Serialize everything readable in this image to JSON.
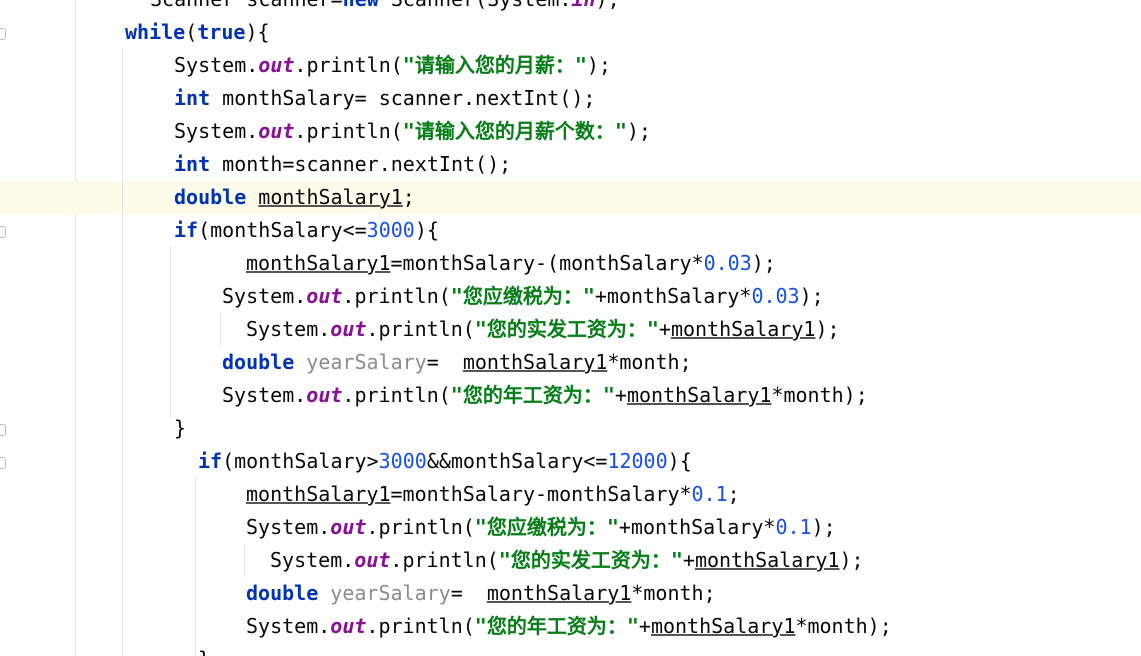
{
  "editor": {
    "language": "Java",
    "colors": {
      "keyword": "#0033b3",
      "static_field": "#871094",
      "string": "#067d17",
      "number": "#1750eb",
      "plain": "#080808",
      "unused_variable": "#8c8c8c",
      "current_line_highlight": "#fdfbe9"
    },
    "lines": [
      {
        "tokens": [
          {
            "t": "Scanner ",
            "c": "plain"
          },
          {
            "t": "scanner",
            "c": "plain"
          },
          {
            "t": "=",
            "c": "plain"
          },
          {
            "t": "new",
            "c": "kw"
          },
          {
            "t": " Scanner(System.",
            "c": "plain"
          },
          {
            "t": "in",
            "c": "fld"
          },
          {
            "t": ");",
            "c": "plain"
          }
        ]
      },
      {
        "tokens": [
          {
            "t": "while",
            "c": "kw"
          },
          {
            "t": "(",
            "c": "plain"
          },
          {
            "t": "true",
            "c": "kw"
          },
          {
            "t": "){",
            "c": "plain"
          }
        ]
      },
      {
        "tokens": [
          {
            "t": "System.",
            "c": "plain"
          },
          {
            "t": "out",
            "c": "fld"
          },
          {
            "t": ".println(",
            "c": "plain"
          },
          {
            "t": "\"",
            "c": "str"
          },
          {
            "t": "请输入您的月薪：",
            "c": "str cjk"
          },
          {
            "t": "\"",
            "c": "str"
          },
          {
            "t": ");",
            "c": "plain"
          }
        ]
      },
      {
        "tokens": [
          {
            "t": "int",
            "c": "kw"
          },
          {
            "t": " monthSalary= scanner.nextInt();",
            "c": "plain"
          }
        ]
      },
      {
        "tokens": [
          {
            "t": "System.",
            "c": "plain"
          },
          {
            "t": "out",
            "c": "fld"
          },
          {
            "t": ".println(",
            "c": "plain"
          },
          {
            "t": "\"",
            "c": "str"
          },
          {
            "t": "请输入您的月薪个数：",
            "c": "str cjk"
          },
          {
            "t": "\"",
            "c": "str"
          },
          {
            "t": ");",
            "c": "plain"
          }
        ]
      },
      {
        "tokens": [
          {
            "t": "int",
            "c": "kw"
          },
          {
            "t": " month=scanner.nextInt();",
            "c": "plain"
          }
        ]
      },
      {
        "tokens": [
          {
            "t": "double",
            "c": "kw"
          },
          {
            "t": " ",
            "c": "plain"
          },
          {
            "t": "monthSalary1",
            "c": "var"
          },
          {
            "t": ";",
            "c": "plain"
          }
        ]
      },
      {
        "tokens": [
          {
            "t": "if",
            "c": "kw"
          },
          {
            "t": "(monthSalary<=",
            "c": "plain"
          },
          {
            "t": "3000",
            "c": "num"
          },
          {
            "t": "){",
            "c": "plain"
          }
        ]
      },
      {
        "tokens": [
          {
            "t": "monthSalary1",
            "c": "var"
          },
          {
            "t": "=monthSalary-(monthSalary*",
            "c": "plain"
          },
          {
            "t": "0.03",
            "c": "num"
          },
          {
            "t": ");",
            "c": "plain"
          }
        ]
      },
      {
        "tokens": [
          {
            "t": "System.",
            "c": "plain"
          },
          {
            "t": "out",
            "c": "fld"
          },
          {
            "t": ".println(",
            "c": "plain"
          },
          {
            "t": "\"",
            "c": "str"
          },
          {
            "t": "您应缴税为：",
            "c": "str cjk"
          },
          {
            "t": "\"",
            "c": "str"
          },
          {
            "t": "+monthSalary*",
            "c": "plain"
          },
          {
            "t": "0.03",
            "c": "num"
          },
          {
            "t": ");",
            "c": "plain"
          }
        ]
      },
      {
        "tokens": [
          {
            "t": "System.",
            "c": "plain"
          },
          {
            "t": "out",
            "c": "fld"
          },
          {
            "t": ".println(",
            "c": "plain"
          },
          {
            "t": "\"",
            "c": "str"
          },
          {
            "t": "您的实发工资为：",
            "c": "str cjk"
          },
          {
            "t": "\"",
            "c": "str"
          },
          {
            "t": "+",
            "c": "plain"
          },
          {
            "t": "monthSalary1",
            "c": "var"
          },
          {
            "t": ");",
            "c": "plain"
          }
        ]
      },
      {
        "tokens": [
          {
            "t": "double",
            "c": "kw"
          },
          {
            "t": " ",
            "c": "plain"
          },
          {
            "t": "yearSalary",
            "c": "unused"
          },
          {
            "t": "=  ",
            "c": "plain"
          },
          {
            "t": "monthSalary1",
            "c": "var"
          },
          {
            "t": "*month;",
            "c": "plain"
          }
        ]
      },
      {
        "tokens": [
          {
            "t": "System.",
            "c": "plain"
          },
          {
            "t": "out",
            "c": "fld"
          },
          {
            "t": ".println(",
            "c": "plain"
          },
          {
            "t": "\"",
            "c": "str"
          },
          {
            "t": "您的年工资为：",
            "c": "str cjk"
          },
          {
            "t": "\"",
            "c": "str"
          },
          {
            "t": "+",
            "c": "plain"
          },
          {
            "t": "monthSalary1",
            "c": "var"
          },
          {
            "t": "*month);",
            "c": "plain"
          }
        ]
      },
      {
        "tokens": [
          {
            "t": "}",
            "c": "plain"
          }
        ]
      },
      {
        "tokens": [
          {
            "t": "if",
            "c": "kw"
          },
          {
            "t": "(monthSalary>",
            "c": "plain"
          },
          {
            "t": "3000",
            "c": "num"
          },
          {
            "t": "&&monthSalary<=",
            "c": "plain"
          },
          {
            "t": "12000",
            "c": "num"
          },
          {
            "t": "){",
            "c": "plain"
          }
        ]
      },
      {
        "tokens": [
          {
            "t": "monthSalary1",
            "c": "var"
          },
          {
            "t": "=monthSalary-monthSalary*",
            "c": "plain"
          },
          {
            "t": "0.1",
            "c": "num"
          },
          {
            "t": ";",
            "c": "plain"
          }
        ]
      },
      {
        "tokens": [
          {
            "t": "System.",
            "c": "plain"
          },
          {
            "t": "out",
            "c": "fld"
          },
          {
            "t": ".println(",
            "c": "plain"
          },
          {
            "t": "\"",
            "c": "str"
          },
          {
            "t": "您应缴税为：",
            "c": "str cjk"
          },
          {
            "t": "\"",
            "c": "str"
          },
          {
            "t": "+monthSalary*",
            "c": "plain"
          },
          {
            "t": "0.1",
            "c": "num"
          },
          {
            "t": ");",
            "c": "plain"
          }
        ]
      },
      {
        "tokens": [
          {
            "t": "System.",
            "c": "plain"
          },
          {
            "t": "out",
            "c": "fld"
          },
          {
            "t": ".println(",
            "c": "plain"
          },
          {
            "t": "\"",
            "c": "str"
          },
          {
            "t": "您的实发工资为：",
            "c": "str cjk"
          },
          {
            "t": "\"",
            "c": "str"
          },
          {
            "t": "+",
            "c": "plain"
          },
          {
            "t": "monthSalary1",
            "c": "var"
          },
          {
            "t": ");",
            "c": "plain"
          }
        ]
      },
      {
        "tokens": [
          {
            "t": "double",
            "c": "kw"
          },
          {
            "t": " ",
            "c": "plain"
          },
          {
            "t": "yearSalary",
            "c": "unused"
          },
          {
            "t": "=  ",
            "c": "plain"
          },
          {
            "t": "monthSalary1",
            "c": "var"
          },
          {
            "t": "*month;",
            "c": "plain"
          }
        ]
      },
      {
        "tokens": [
          {
            "t": "System.",
            "c": "plain"
          },
          {
            "t": "out",
            "c": "fld"
          },
          {
            "t": ".println(",
            "c": "plain"
          },
          {
            "t": "\"",
            "c": "str"
          },
          {
            "t": "您的年工资为：",
            "c": "str cjk"
          },
          {
            "t": "\"",
            "c": "str"
          },
          {
            "t": "+",
            "c": "plain"
          },
          {
            "t": "monthSalary1",
            "c": "var"
          },
          {
            "t": "*month);",
            "c": "plain"
          }
        ]
      },
      {
        "tokens": [
          {
            "t": "}",
            "c": "plain"
          }
        ]
      }
    ]
  }
}
